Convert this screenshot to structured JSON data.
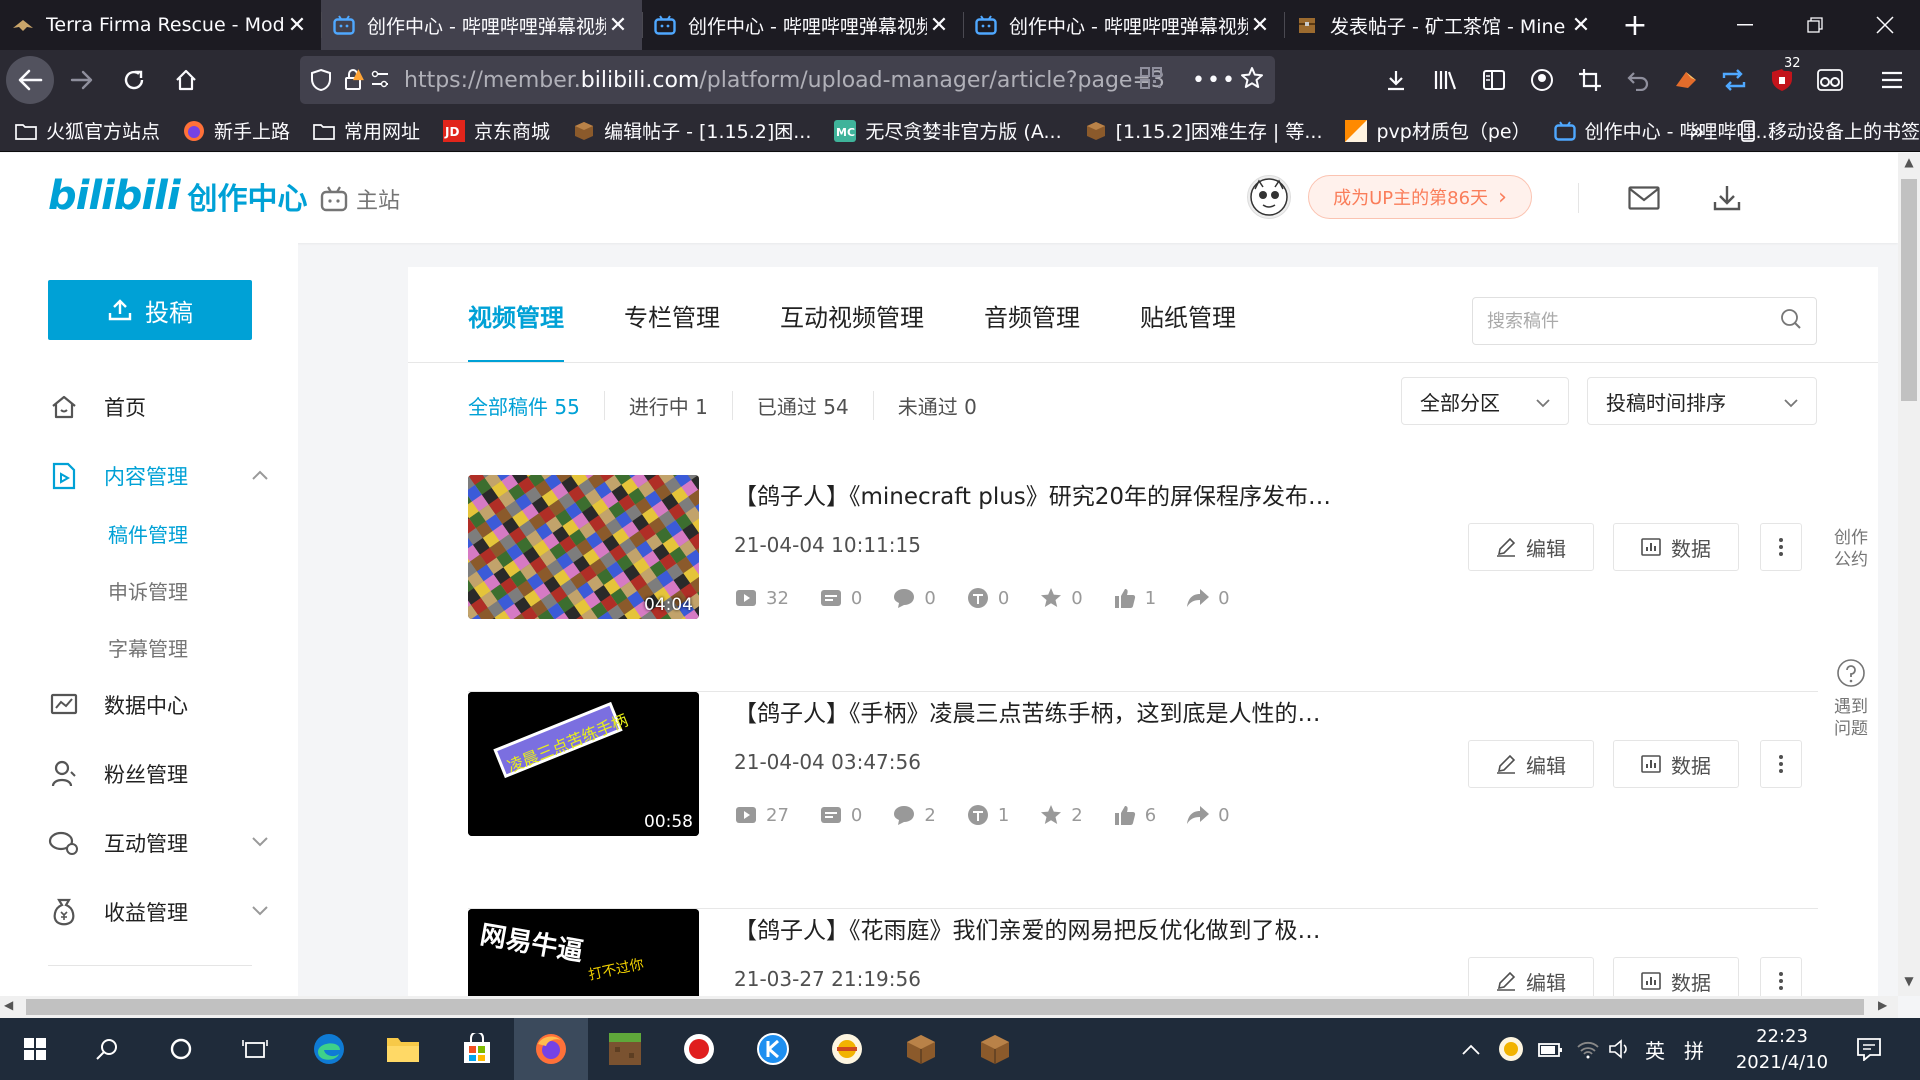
{
  "browser": {
    "tabs": [
      {
        "title": "Terra Firma Rescue - Modp",
        "active": false
      },
      {
        "title": "创作中心 - 哔哩哔哩弹幕视频",
        "active": true
      },
      {
        "title": "创作中心 - 哔哩哔哩弹幕视频",
        "active": false
      },
      {
        "title": "创作中心 - 哔哩哔哩弹幕视频",
        "active": false
      },
      {
        "title": "发表帖子 - 矿工茶馆 - Mine",
        "active": false
      }
    ],
    "new_tab": "+",
    "url_prefix": "https://member.",
    "url_domain": "bilibili.com",
    "url_path": "/platform/upload-manager/article?page=3",
    "notif_badge": "32",
    "bookmarks": [
      {
        "label": "火狐官方站点",
        "icon": "folder-icon"
      },
      {
        "label": "新手上路",
        "icon": "firefox-icon"
      },
      {
        "label": "常用网址",
        "icon": "folder-icon"
      },
      {
        "label": "京东商城",
        "icon": "jd-icon"
      },
      {
        "label": "编辑帖子 - [1.15.2]困...",
        "icon": "block-icon"
      },
      {
        "label": "无尽贪婪非官方版 (A...",
        "icon": "mc-icon"
      },
      {
        "label": "[1.15.2]困难生存 | 等...",
        "icon": "block-icon"
      },
      {
        "label": "pvp材质包（pe）",
        "icon": "pvp-icon"
      },
      {
        "label": "创作中心 - 哔哩哔哩...",
        "icon": "bili-icon"
      }
    ],
    "bookmark_overflow": "»",
    "mobile_bookmarks": "移动设备上的书签"
  },
  "header": {
    "logo_text": "bilibili",
    "logo_sub": "创作中心",
    "main_site": "主站",
    "up_badge": "成为UP主的第86天",
    "up_badge_arrow": "›"
  },
  "sidebar": {
    "upload_label": "投稿",
    "items": [
      {
        "label": "首页",
        "icon": "home-icon"
      },
      {
        "label": "内容管理",
        "icon": "content-icon",
        "expanded": true
      },
      {
        "label": "数据中心",
        "icon": "chart-icon"
      },
      {
        "label": "粉丝管理",
        "icon": "fans-icon"
      },
      {
        "label": "互动管理",
        "icon": "interact-icon"
      },
      {
        "label": "收益管理",
        "icon": "income-icon"
      }
    ],
    "subitems": [
      "稿件管理",
      "申诉管理",
      "字幕管理"
    ]
  },
  "main": {
    "tabs": [
      "视频管理",
      "专栏管理",
      "互动视频管理",
      "音频管理",
      "贴纸管理"
    ],
    "search_placeholder": "搜索稿件",
    "filters": [
      "全部稿件 55",
      "进行中 1",
      "已通过 54",
      "未通过 0"
    ],
    "dropdown_zone": "全部分区",
    "dropdown_sort": "投稿时间排序",
    "edit_label": "编辑",
    "data_label": "数据",
    "videos": [
      {
        "title": "【鸽子人】《minecraft plus》研究20年的屏保程序发布…",
        "date": "21-04-04 10:11:15",
        "duration": "04:04",
        "stats": {
          "play": "32",
          "danmaku": "0",
          "comment": "0",
          "coin": "0",
          "favorite": "0",
          "like": "1",
          "share": "0"
        }
      },
      {
        "title": "【鸽子人】《手柄》凌晨三点苦练手柄，这到底是人性的…",
        "date": "21-04-04 03:47:56",
        "duration": "00:58",
        "thumb_text": "凌晨三点苦练手柄",
        "stats": {
          "play": "27",
          "danmaku": "0",
          "comment": "2",
          "coin": "1",
          "favorite": "2",
          "like": "6",
          "share": "0"
        }
      },
      {
        "title": "【鸽子人】《花雨庭》我们亲爱的网易把反优化做到了极…",
        "date": "21-03-27 21:19:56",
        "duration": "",
        "thumb_text": "网易牛逼",
        "thumb_text2": "打不过你",
        "stats": {}
      }
    ]
  },
  "floating": {
    "convention": [
      "创作",
      "公约"
    ],
    "help": [
      "遇到",
      "问题"
    ]
  },
  "taskbar": {
    "lang": "英",
    "ime": "拼",
    "time": "22:23",
    "date": "2021/4/10"
  },
  "colors": {
    "accent": "#00a1d6",
    "badge_orange": "#fa7d5a",
    "taskbar": "#1f2b3a"
  }
}
